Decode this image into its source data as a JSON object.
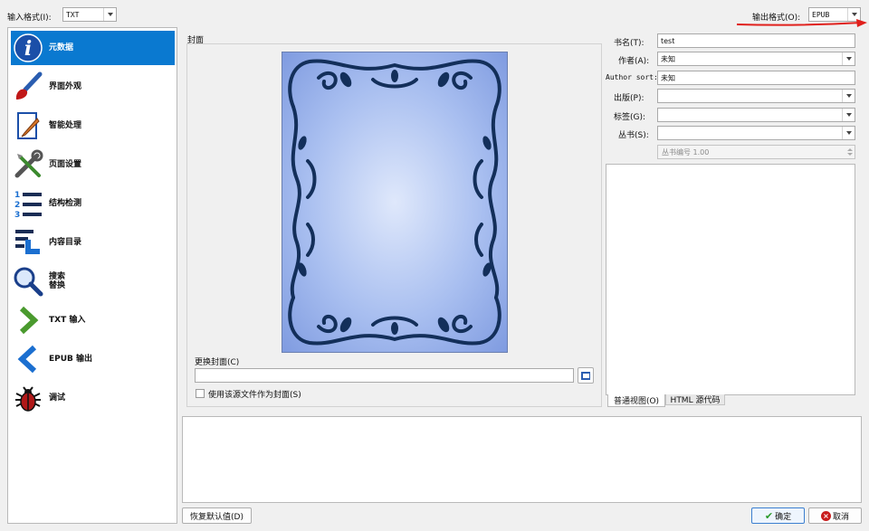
{
  "input_format": {
    "label": "输入格式(I):",
    "value": "TXT"
  },
  "output_format": {
    "label": "输出格式(O):",
    "value": "EPUB"
  },
  "sidebar": {
    "items": [
      {
        "label": "元数据",
        "icon": "info-icon"
      },
      {
        "label": "界面外观",
        "icon": "brush-icon"
      },
      {
        "label": "智能处理",
        "icon": "pencil-icon"
      },
      {
        "label": "页面设置",
        "icon": "tools-icon"
      },
      {
        "label": "结构检测",
        "icon": "numbered-list-icon"
      },
      {
        "label": "内容目录",
        "icon": "toc-icon"
      },
      {
        "label": "搜索\n替换",
        "icon": "magnifier-icon"
      },
      {
        "label": "TXT 输入",
        "icon": "input-arrow-icon"
      },
      {
        "label": "EPUB 输出",
        "icon": "output-arrow-icon"
      },
      {
        "label": "调试",
        "icon": "bug-icon"
      }
    ]
  },
  "cover": {
    "group_title": "封面",
    "change_label": "更换封面(C)",
    "change_path": "",
    "use_source_label": "使用该源文件作为封面(S)"
  },
  "metadata": {
    "title_label": "书名(T):",
    "title_value": "test",
    "author_label": "作者(A):",
    "author_value": "未知",
    "author_sort_label": "Author sort:",
    "author_sort_value": "未知",
    "publisher_label": "出版(P):",
    "publisher_value": "",
    "tags_label": "标签(G):",
    "tags_value": "",
    "series_label": "丛书(S):",
    "series_value": "",
    "series_index": "丛书编号 1.00"
  },
  "comments": {
    "tab_normal": "普通视图(O)",
    "tab_html": "HTML 源代码"
  },
  "buttons": {
    "restore_defaults": "恢复默认值(D)",
    "ok": "确定",
    "cancel": "取消"
  },
  "colors": {
    "selection": "#0a79d0",
    "accent_arrow": "#e0201c"
  }
}
